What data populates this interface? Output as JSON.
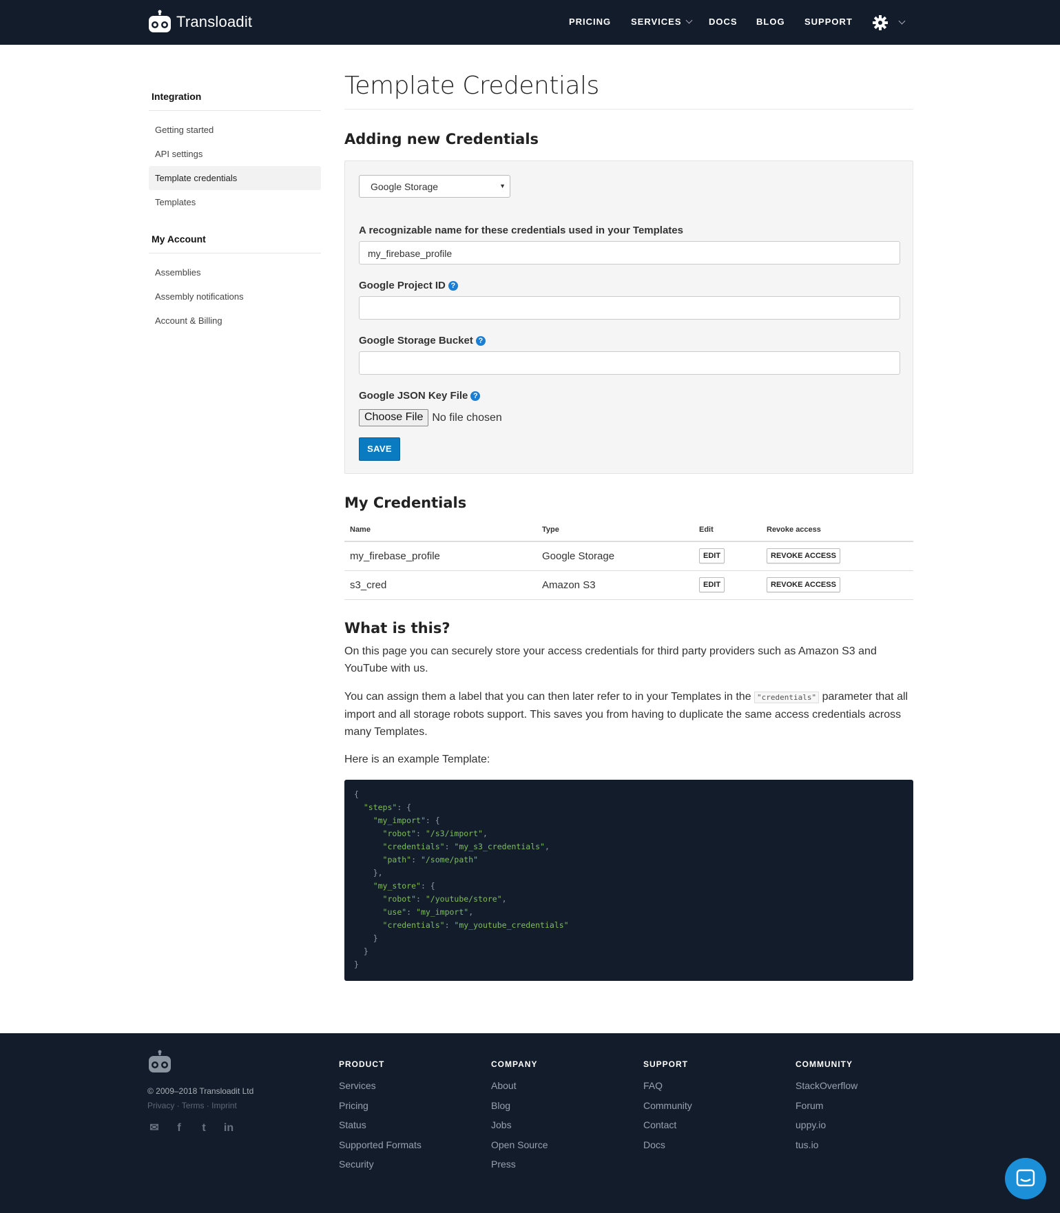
{
  "brand": {
    "name": "Transloadit"
  },
  "nav": {
    "items": [
      "PRICING",
      "SERVICES",
      "DOCS",
      "BLOG",
      "SUPPORT"
    ]
  },
  "sidebar": {
    "sections": [
      {
        "heading": "Integration",
        "items": [
          "Getting started",
          "API settings",
          "Template credentials",
          "Templates"
        ]
      },
      {
        "heading": "My Account",
        "items": [
          "Assemblies",
          "Assembly notifications",
          "Account & Billing"
        ]
      }
    ],
    "active": "Template credentials"
  },
  "page": {
    "title": "Template Credentials"
  },
  "form": {
    "section_title": "Adding new Credentials",
    "provider_selected": "Google Storage",
    "name_label": "A recognizable name for these credentials used in your Templates",
    "name_value": "my_firebase_profile",
    "project_label": "Google Project ID",
    "project_value": "",
    "bucket_label": "Google Storage Bucket",
    "bucket_value": "",
    "keyfile_label": "Google JSON Key File",
    "choose_file_label": "Choose File",
    "file_status": "No file chosen",
    "save_label": "SAVE",
    "help_glyph": "?"
  },
  "credentials": {
    "section_title": "My Credentials",
    "columns": [
      "Name",
      "Type",
      "Edit",
      "Revoke access"
    ],
    "rows": [
      {
        "name": "my_firebase_profile",
        "type": "Google Storage",
        "edit": "EDIT",
        "revoke": "REVOKE ACCESS"
      },
      {
        "name": "s3_cred",
        "type": "Amazon S3",
        "edit": "EDIT",
        "revoke": "REVOKE ACCESS"
      }
    ]
  },
  "info": {
    "section_title": "What is this?",
    "p1": "On this page you can securely store your access credentials for third party providers such as Amazon S3 and YouTube with us.",
    "p2_before": "You can assign them a label that you can then later refer to in your Templates in the ",
    "p2_code": "\"credentials\"",
    "p2_after": " parameter that all import and all storage robots support. This saves you from having to duplicate the same access credentials across many Templates.",
    "p3": "Here is an example Template:"
  },
  "footer": {
    "copyright": "© 2009–2018 Transloadit Ltd",
    "legal": "Privacy · Terms · Imprint",
    "columns": [
      {
        "heading": "PRODUCT",
        "links": [
          "Services",
          "Pricing",
          "Status",
          "Supported Formats",
          "Security"
        ]
      },
      {
        "heading": "COMPANY",
        "links": [
          "About",
          "Blog",
          "Jobs",
          "Open Source",
          "Press"
        ]
      },
      {
        "heading": "SUPPORT",
        "links": [
          "FAQ",
          "Community",
          "Contact",
          "Docs"
        ]
      },
      {
        "heading": "COMMUNITY",
        "links": [
          "StackOverflow",
          "Forum",
          "uppy.io",
          "tus.io"
        ]
      }
    ]
  },
  "colors": {
    "navbar": "#121c2b",
    "accent": "#0a7bc1",
    "help": "#1b7ed2",
    "code_string": "#7fbd5e"
  }
}
